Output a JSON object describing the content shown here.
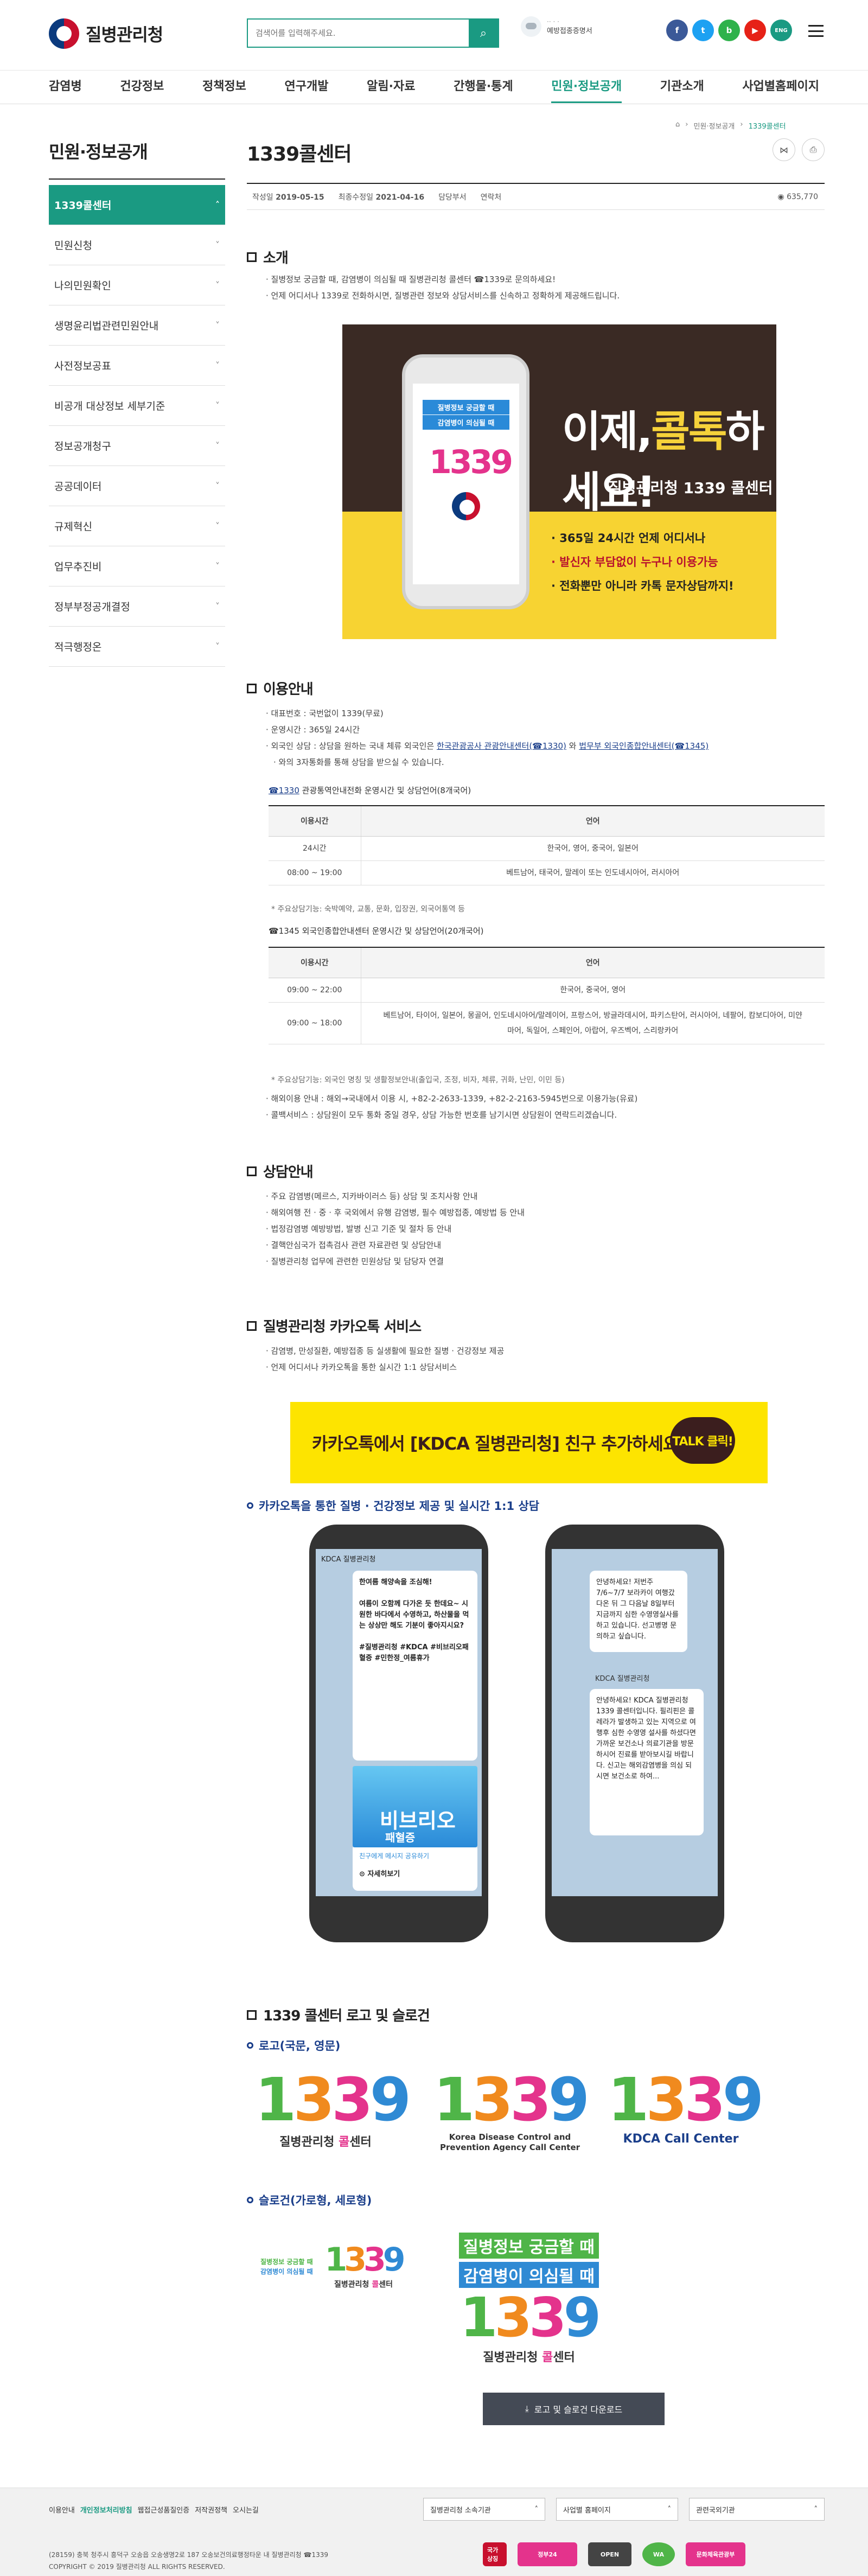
{
  "header": {
    "logo_text": "질병관리청",
    "search_placeholder": "검색어를 입력해주세요.",
    "weather_line1": "·· · ·",
    "weather_line2": "예방접종증명서",
    "sns_eng": "ENG"
  },
  "gnb": [
    "감염병",
    "건강정보",
    "정책정보",
    "연구개발",
    "알림·자료",
    "간행물·통계",
    "민원·정보공개",
    "기관소개",
    "사업별홈페이지"
  ],
  "breadcrumb": [
    "민원·정보공개",
    "1339콜센터"
  ],
  "sidebar": {
    "title": "민원·정보공개",
    "items": [
      "1339콜센터",
      "민원신청",
      "나의민원확인",
      "생명윤리법관련민원안내",
      "사전정보공표",
      "비공개 대상정보 세부기준",
      "정보공개청구",
      "공공데이터",
      "규제혁신",
      "업무추진비",
      "정부부정공개결정",
      "적극행정온"
    ]
  },
  "page": {
    "title": "1339콜센터",
    "meta_created_label": "작성일",
    "meta_created": "2019-05-15",
    "meta_modified_label": "최종수정일",
    "meta_modified": "2021-04-16",
    "meta_dept": "담당부서",
    "meta_contact": "연락처",
    "views": "635,770"
  },
  "intro": {
    "heading": "소개",
    "bullets": [
      "질병정보 궁금할 때, 감염병이 의심될 때 질병관리청 콜센터 ☎1339로 문의하세요!",
      "언제 어디서나 1339로 전화하시면, 질병관련 정보와 상담서비스를 신속하고 정확하게 제공해드립니다."
    ]
  },
  "promo": {
    "big_text": "이제,",
    "big_em": "콜톡",
    "big_tail": "하세요!",
    "sub": "질병관리청 1339 콜센터",
    "lines": [
      "365일 24시간 언제 어디서나",
      "발신자 부담없이 누구나 이용가능",
      "전화뿐만 아니라 카톡 문자상담까지!"
    ],
    "phone_l1": "질병정보 궁금할 때",
    "phone_l2": "감염병이 의심될 때",
    "phone_num": "1339"
  },
  "usage": {
    "heading": "이용안내",
    "b1": "대표번호 : 국번없이 1339(무료)",
    "b2": "운영시간 : 365일 24시간",
    "b3_pre": "외국인 상담 : 상담을 원하는 국내 체류 외국인은 ",
    "b3_link1": "한국관광공사 관광안내센터(☎1330)",
    "b3_mid": " 와 ",
    "b3_link2": "법무부 외국인종합안내센터(☎1345)",
    "b3_post": "",
    "b3_line2": "와의 3자통화를 통해 상담을 받으실 수 있습니다.",
    "t1_cap_link": "☎1330",
    "t1_cap": " 관광통역안내전화 운영시간 및 상담언어(8개국어)",
    "t1_head": [
      "이용시간",
      "언어"
    ],
    "t1_rows": [
      [
        "24시간",
        "한국어, 영어, 중국어, 일본어"
      ],
      [
        "08:00 ~ 19:00",
        "베트남어, 태국어, 말레이 또는 인도네시아어, 러시아어"
      ]
    ],
    "t1_note": "* 주요상담기능: 숙박예약, 교통, 문화, 입장권, 외국어통역 등",
    "t2_cap": "☎1345 외국인종합안내센터 운영시간 및 상담언어(20개국어)",
    "t2_head": [
      "이용시간",
      "언어"
    ],
    "t2_rows": [
      [
        "09:00 ~ 22:00",
        "한국어, 중국어, 영어"
      ],
      [
        "09:00 ~ 18:00",
        "베트남어, 타이어, 일본어, 몽골어, 인도네시아어/말레이어, 프랑스어, 방글라데시어, 파키스탄어, 러시아어, 네팔어, 캄보디아어, 미얀마어, 독일어, 스페인어, 아랍어, 우즈벡어, 스리랑카어"
      ]
    ],
    "t2_note": "* 주요상담기능: 외국인 명칭 및 생활정보안내(출입국, 조정, 비자, 체류, 귀화, 난민, 이민 등)",
    "b4": "해외이용 안내 : 해외→국내에서 이용 시, +82-2-2633-1339, +82-2-2163-5945번으로 이용가능(유료)",
    "b5": "콜백서비스 : 상담원이 모두 통화 중일 경우, 상담 가능한 번호를 남기시면 상담원이 연락드리겠습니다."
  },
  "consult": {
    "heading": "상담안내",
    "bullets": [
      "주요 감염병(메르스, 지카바이러스 등) 상담 및 조치사항 안내",
      "해외여행 전 · 중 · 후 국외에서 유행 감염병, 필수 예방접종, 예방법 등 안내",
      "법정감염병 예방방법, 발병 신고 기준 및 절차 등 안내",
      "결핵안심국가 접촉검사 관련 자료관련 및 상담안내",
      "질병관리청 업무에 관련한 민원상담 및 담당자 연결"
    ]
  },
  "kakao": {
    "heading": "질병관리청 카카오톡 서비스",
    "bullets": [
      "감염병, 만성질환, 예방접종 등 실생활에 필요한 질병 · 건강정보 제공",
      "언제 어디서나 카카오톡을 통한 실시간 1:1 상담서비스"
    ],
    "banner": "카카오톡에서 [KDCA 질병관리청] 친구 추가하세요!",
    "banner_bubble": "TALK 클릭!",
    "sub_heading": "카카오톡을 통한 질병 · 건강정보 제공 및 실시간 1:1 상담",
    "chat_name": "KDCA 질병관리청",
    "chat1": "한여름 해양속을 조심해!",
    "chat2": "여름이 오함께 다가온 듯 한데요~ 시원한 바다에서 수영하고, 하산물을 먹는 상상만 해도 기분이 좋아지시요?",
    "chat3": "#질병관리청 #KDCA #비브리오패혈증 #민한정_여름휴가",
    "vbanner_title": "비브리오",
    "vbanner_sub": "패혈증",
    "share": "친구에게 메시지 공유하기",
    "detail": "자세히보기",
    "chat_right1": "안녕하세요! 저번주 7/6~7/7 보라카이 여행갔다온 뒤 그 다음날 8일부터 지금까지 심한 수영영실사를 하고 있습니다. 선고병명 문의하고 싶습니다.",
    "chat_right2": "안녕하세요! KDCA 질병관리청 1339 콜센터입니다. 필리핀은 콜레라가 발생하고 있는 지역으로 여행후 심한 수영영 설사를 하셨다면 가까운 보건소나 의료기관을 방문하시어 진료를 받아보시길 바랍니다. 신고는 해외감염병을 의심 되시면 보건소로 하여..."
  },
  "logos": {
    "heading": "1339 콜센터 로고 및 슬로건",
    "sub1": "로고(국문, 영문)",
    "digits": [
      "1",
      "3",
      "3",
      "9"
    ],
    "cap_kr_pre": "질병관리청 ",
    "cap_kr_b": "콜",
    "cap_kr_post": "센터",
    "cap_en1": "Korea Disease Control and",
    "cap_en2": "Prevention Agency Call Center",
    "cap_kdca": "KDCA Call Center",
    "sub2": "슬로건(가로형, 세로형)",
    "slogan1": "질병정보 궁금할 때",
    "slogan2": "감염병이 의심될 때",
    "download": "로고 및 슬로건 다운로드"
  },
  "footer": {
    "links": [
      "이용안내",
      "개인정보처리방침",
      "웹접근성품질인증",
      "저작권정책",
      "오시는길"
    ],
    "sel1": "질병관리청 소속기관",
    "sel2": "사업별 홈페이지",
    "sel3": "관련국외기관",
    "addr": "(28159) 충북 청주시 흥덕구 오송읍 오송생명2로 187 오송보건의료행정타운 내 질병관리청 ☎1339",
    "copy": "COPYRIGHT © 2019 질병관리청 ALL RIGHTS RESERVED.",
    "marks": [
      "국가상징",
      "정부24",
      "OPEN",
      "WA",
      "문화체육관광부"
    ]
  },
  "colors": {
    "accent": "#1a9a82",
    "navy": "#1a3e8a",
    "kakao": "#fde400"
  }
}
